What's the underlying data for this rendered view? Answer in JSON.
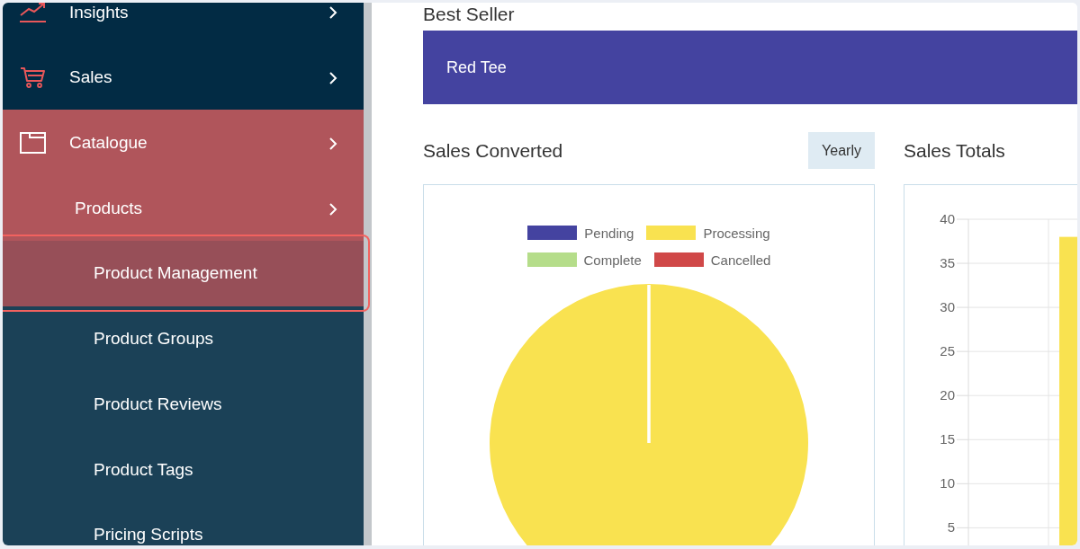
{
  "sidebar": {
    "items": [
      {
        "label": "Insights",
        "expanded": false,
        "selected": false
      },
      {
        "label": "Sales",
        "expanded": false,
        "selected": false
      },
      {
        "label": "Catalogue",
        "expanded": true,
        "selected": false,
        "children": [
          {
            "label": "Products",
            "expanded": true,
            "selected": false,
            "children": [
              {
                "label": "Product Management",
                "selected": true,
                "highlighted": true
              },
              {
                "label": "Product Groups",
                "selected": false,
                "highlighted": false
              },
              {
                "label": "Product Reviews",
                "selected": false,
                "highlighted": false
              },
              {
                "label": "Product Tags",
                "selected": false,
                "highlighted": false
              },
              {
                "label": "Pricing Scripts",
                "selected": false,
                "highlighted": false
              }
            ]
          }
        ]
      }
    ]
  },
  "best_seller": {
    "heading": "Best Seller",
    "product": "Red Tee"
  },
  "sales_converted": {
    "title": "Sales Converted",
    "period_button": "Yearly",
    "legend": [
      {
        "label": "Pending",
        "color": "#4443a0"
      },
      {
        "label": "Processing",
        "color": "#f9e250"
      },
      {
        "label": "Complete",
        "color": "#b5dd8a"
      },
      {
        "label": "Cancelled",
        "color": "#d04848"
      }
    ]
  },
  "sales_totals": {
    "title": "Sales Totals",
    "chart_data": {
      "type": "bar",
      "series": [
        {
          "color": "#f9e250",
          "values": [
            null,
            38
          ]
        }
      ],
      "ylim": [
        3,
        40
      ],
      "yticks": [
        5,
        10,
        15,
        20,
        25,
        30,
        35,
        40
      ],
      "grid": true
    }
  }
}
